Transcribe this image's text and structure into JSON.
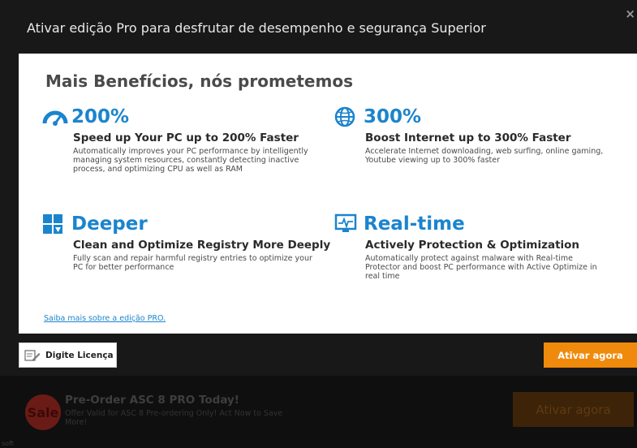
{
  "dialog": {
    "title": "Ativar edição Pro para desfrutar de desempenho e segurança Superior",
    "close_symbol": "×"
  },
  "panel": {
    "heading": "Mais Benefícios, nós prometemos",
    "benefits": [
      {
        "icon": "speedometer-icon",
        "big": "200%",
        "sub": "Speed up Your PC up to 200% Faster",
        "desc": "Automatically improves your PC performance by intelligently managing system resources, constantly detecting inactive process, and optimizing CPU as well as RAM"
      },
      {
        "icon": "globe-icon",
        "big": "300%",
        "sub": "Boost Internet up to 300% Faster",
        "desc": "Accelerate Internet downloading, web surfing, online gaming, Youtube viewing up to 300% faster"
      },
      {
        "icon": "registry-blocks-icon",
        "big": "Deeper",
        "sub": "Clean and Optimize Registry More Deeply",
        "desc": "Fully scan and repair harmful registry entries to optimize your PC for better performance"
      },
      {
        "icon": "monitor-pulse-icon",
        "big": "Real-time",
        "sub": "Actively Protection & Optimization",
        "desc": "Automatically protect against malware with Real-time Protector and boost PC performance with Active Optimize in real time"
      }
    ],
    "learn_more": "Saiba mais sobre a edição PRO."
  },
  "footer": {
    "license_label": "Digite Licença",
    "activate_label": "Ativar agora"
  },
  "promo": {
    "badge": "Sale",
    "title": "Pre-Order ASC 8 PRO Today!",
    "desc": "Offer Valid for ASC 8 Pre-ordering Only! Act Now to Save More!",
    "button": "Ativar agora",
    "corner": "soft"
  },
  "colors": {
    "accent_blue": "#1b84ce",
    "orange": "#f08a0c",
    "dark_bg": "#181818"
  }
}
